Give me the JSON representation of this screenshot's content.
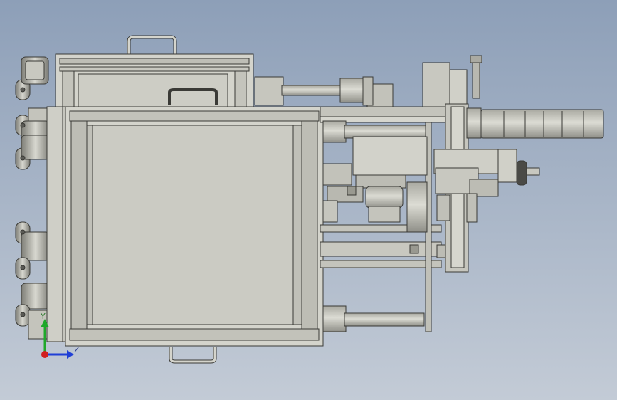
{
  "viewport": {
    "background_top": "#8d9fb8",
    "background_bottom": "#c3cbd6",
    "model_fill": "#d4d4cc",
    "model_stroke": "#3a3a36",
    "model_shade": "#b9b9b0",
    "model_dark": "#8e8e86"
  },
  "triad": {
    "z_label": "Z",
    "y_label": "Y",
    "z_color": "#1f3fd6",
    "y_color": "#1fa82a",
    "x_color": "#d11f1f",
    "z_icon": "axis-arrow-z",
    "y_icon": "axis-arrow-y",
    "origin_icon": "axis-origin-dot"
  }
}
